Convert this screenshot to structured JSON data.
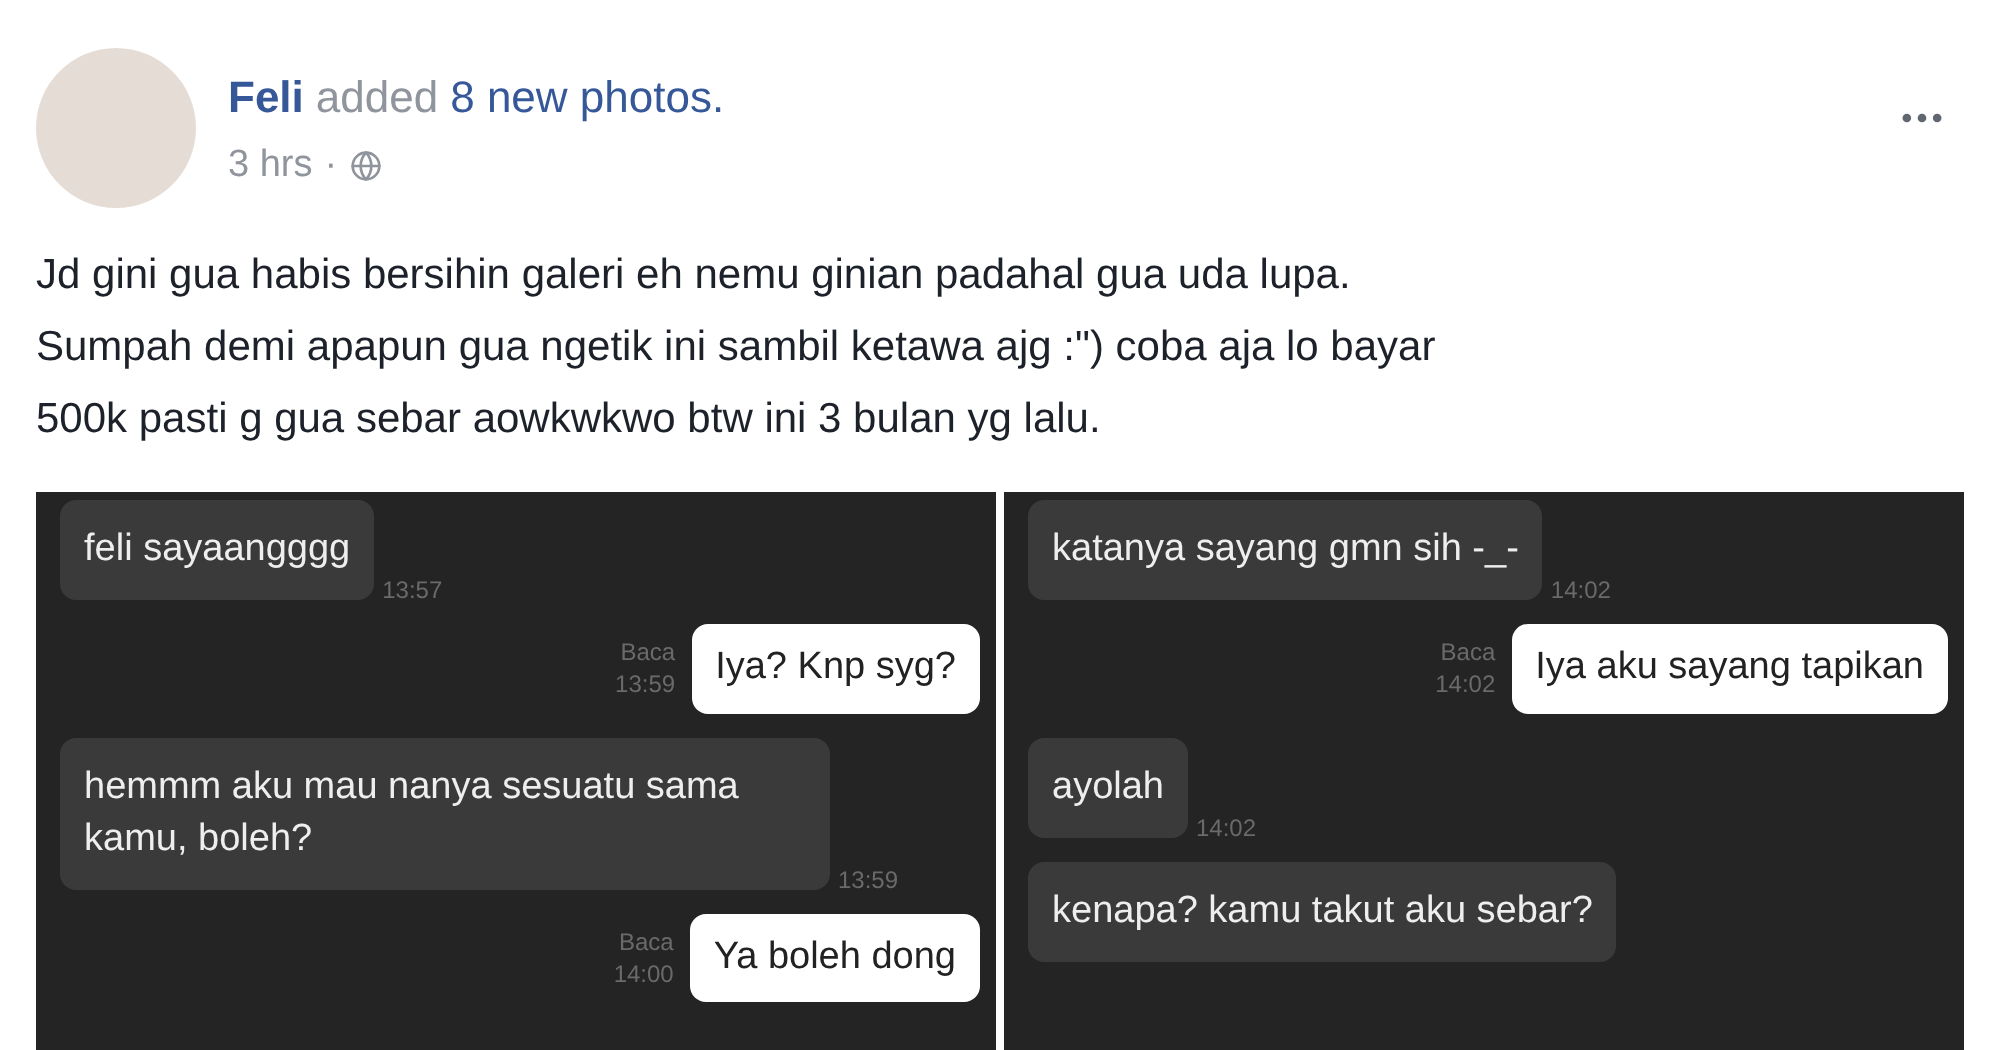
{
  "post": {
    "author": "Feli",
    "action": "added",
    "object": "8 new photos.",
    "time": "3 hrs",
    "separator": "·"
  },
  "text_lines": [
    "Jd gini gua habis bersihin galeri eh nemu ginian padahal gua uda lupa.",
    "Sumpah demi apapun gua ngetik ini sambil ketawa ajg :\") coba aja lo bayar",
    "500k pasti g gua sebar aowkwkwo btw ini 3 bulan yg lalu."
  ],
  "photos": [
    {
      "messages": [
        {
          "kind": "received",
          "text": "feli sayaangggg",
          "time": "13:57"
        },
        {
          "kind": "sent",
          "text": "Iya? Knp syg?",
          "status": "Baca",
          "time": "13:59"
        },
        {
          "kind": "received",
          "text": "hemmm aku mau nanya sesuatu sama kamu, boleh?",
          "time": "13:59"
        },
        {
          "kind": "sent",
          "text": "Ya boleh dong",
          "status": "Baca",
          "time": "14:00"
        }
      ]
    },
    {
      "messages": [
        {
          "kind": "received",
          "text": "katanya sayang gmn sih -_-",
          "time": "14:02"
        },
        {
          "kind": "sent",
          "text": "Iya aku sayang tapikan",
          "status": "Baca",
          "time": "14:02"
        },
        {
          "kind": "received",
          "text": "ayolah",
          "time": "14:02"
        },
        {
          "kind": "received",
          "text": "kenapa? kamu takut aku sebar?"
        }
      ]
    }
  ]
}
